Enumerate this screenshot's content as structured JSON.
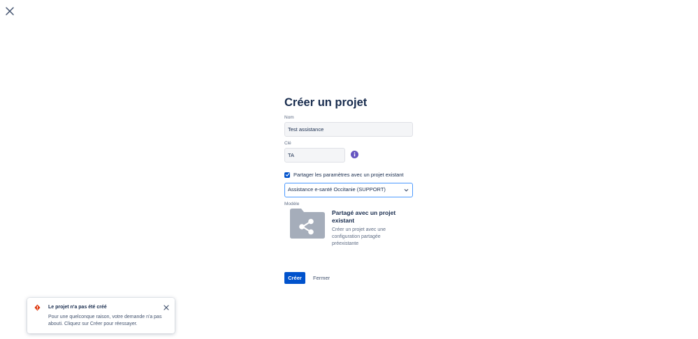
{
  "page": {
    "title": "Créer un projet"
  },
  "form": {
    "name_label": "Nom",
    "name_value": "Test assistance",
    "key_label": "Clé",
    "key_value": "TA",
    "share_checked": true,
    "share_label": "Partager les paramètres avec un projet existant",
    "select_value": "Assistance e-santé Occitanie (SUPPORT)",
    "template_label": "Modèle",
    "template_title": "Partagé avec un projet existant",
    "template_desc": "Créer un projet avec une configuration partagée préexistante"
  },
  "actions": {
    "create_label": "Créer",
    "close_label": "Fermer"
  },
  "toast": {
    "title": "Le projet n'a pas été créé",
    "body": "Pour une quelconque raison, votre demande n'a pas abouti. Cliquez sur Créer pour réessayer."
  },
  "colors": {
    "primary": "#0052cc",
    "error": "#de350b",
    "info": "#6554c0",
    "folder": "#a5adba"
  }
}
